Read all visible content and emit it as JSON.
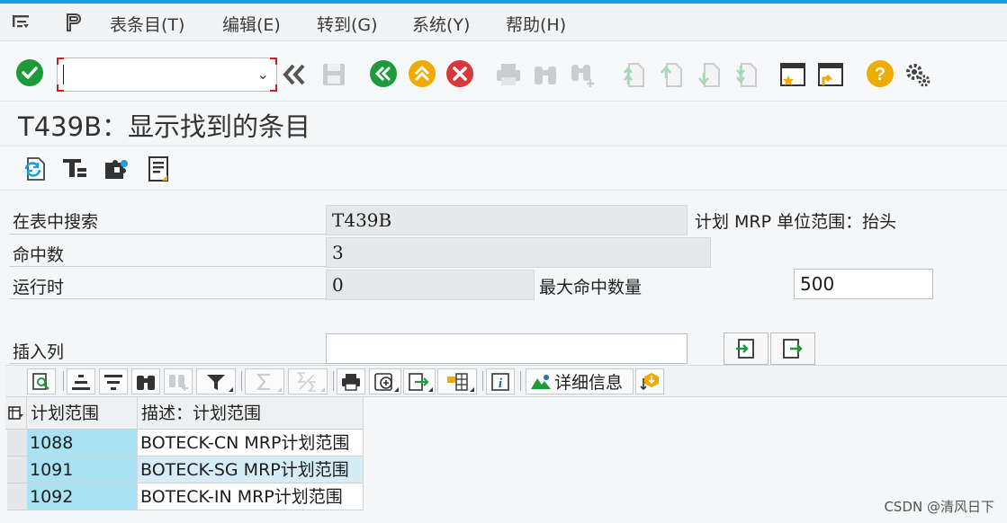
{
  "menu": {
    "items": [
      "表条目(T)",
      "编辑(E)",
      "转到(G)",
      "系统(Y)",
      "帮助(H)"
    ]
  },
  "toolbar": {
    "command_value": ""
  },
  "page": {
    "title": "T439B：显示找到的条目"
  },
  "form": {
    "search_table_label": "在表中搜索",
    "search_table_value": "T439B",
    "table_description": "计划 MRP 单位范围：抬头",
    "hits_label": "命中数",
    "hits_value": "3",
    "runtime_label": "运行时",
    "runtime_value": "0",
    "max_hits_label": "最大命中数量",
    "max_hits_value": "500",
    "insert_col_label": "插入列",
    "insert_col_value": ""
  },
  "grid_toolbar": {
    "details_label": "详细信息"
  },
  "table": {
    "columns": [
      "计划范围",
      "描述：计划范围"
    ],
    "rows": [
      {
        "key": "1088",
        "desc": "BOTECK-CN MRP计划范围"
      },
      {
        "key": "1091",
        "desc": "BOTECK-SG MRP计划范围"
      },
      {
        "key": "1092",
        "desc": "BOTECK-IN MRP计划范围"
      }
    ]
  },
  "watermark": "CSDN @清风日下",
  "colors": {
    "accent": "#1a9fe3",
    "confirm_green": "#1e9a3a",
    "nav_green": "#1e9a3a",
    "nav_yellow": "#f0ab00",
    "cancel_red": "#d9363e",
    "key_cell": "#a9e2f2"
  }
}
